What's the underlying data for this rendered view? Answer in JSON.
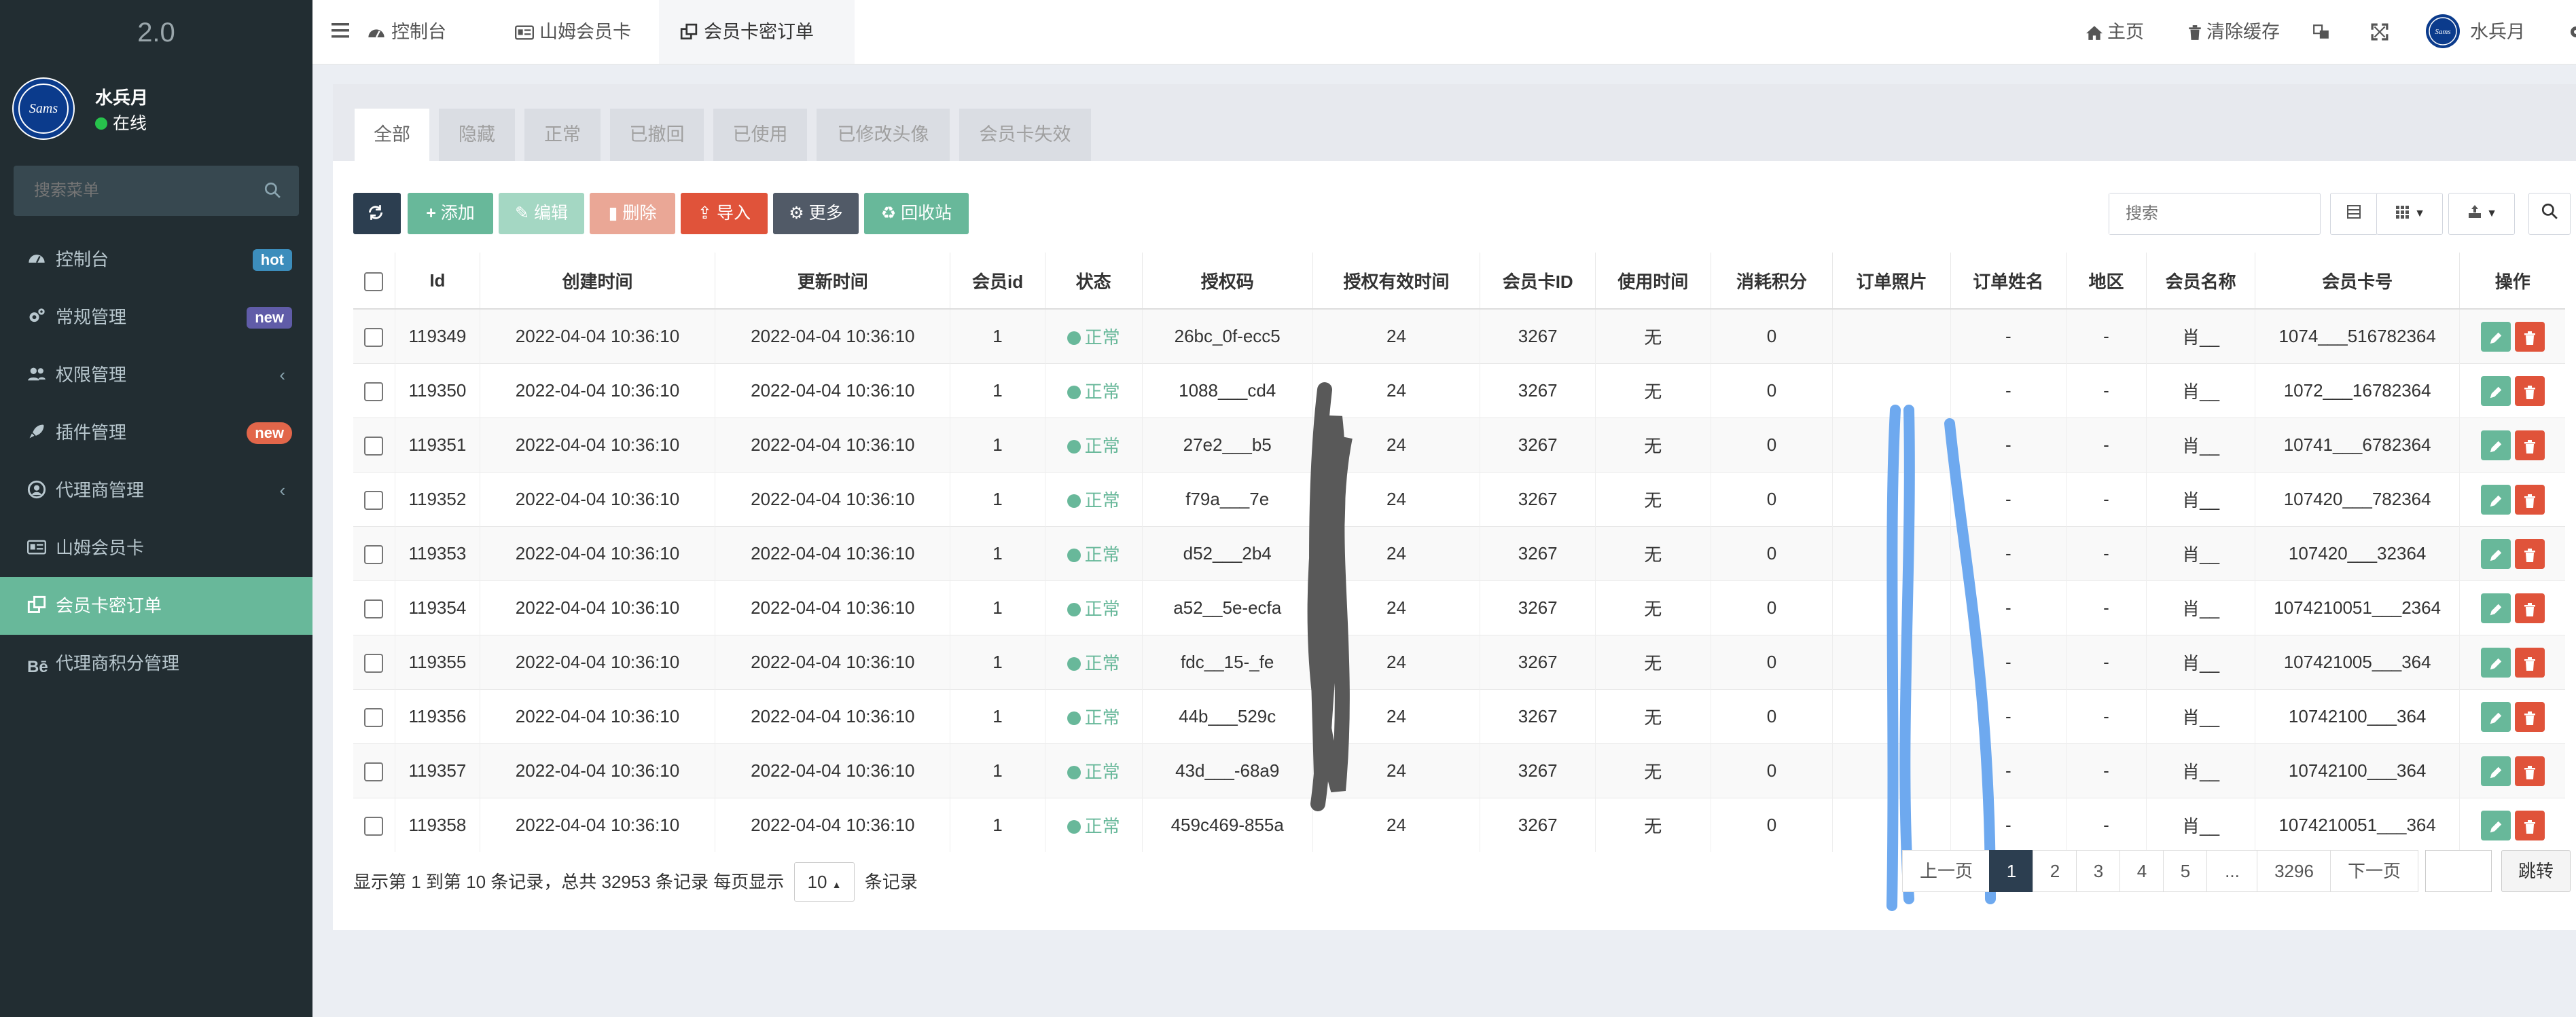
{
  "app": {
    "version": "2.0"
  },
  "user": {
    "name": "水兵月",
    "status": "在线"
  },
  "sidebar_search": {
    "placeholder": "搜索菜单"
  },
  "menu": [
    {
      "label": "控制台",
      "icon": "dashboard-icon",
      "badge": "hot"
    },
    {
      "label": "常规管理",
      "icon": "cogs-icon",
      "badge": "new"
    },
    {
      "label": "权限管理",
      "icon": "users-icon",
      "badge": ""
    },
    {
      "label": "插件管理",
      "icon": "rocket-icon",
      "badge": "new"
    },
    {
      "label": "代理商管理",
      "icon": "user-circle-icon",
      "badge": ""
    },
    {
      "label": "山姆会员卡",
      "icon": "id-card-icon",
      "badge": ""
    },
    {
      "label": "会员卡密订单",
      "icon": "clone-icon",
      "badge": ""
    },
    {
      "label": "代理商积分管理",
      "icon": "behance-icon",
      "badge": ""
    }
  ],
  "top_tabs": [
    "控制台",
    "山姆会员卡",
    "会员卡密订单"
  ],
  "top_right": {
    "home": "主页",
    "clear_cache": "清除缓存",
    "user": "水兵月"
  },
  "filter_tabs": [
    "全部",
    "隐藏",
    "正常",
    "已撤回",
    "已使用",
    "已修改头像",
    "会员卡失效"
  ],
  "toolbar": {
    "add": "添加",
    "edit": "编辑",
    "delete": "删除",
    "import": "导入",
    "more": "更多",
    "recycle": "回收站",
    "search_placeholder": "搜索"
  },
  "table": {
    "headers": [
      "Id",
      "创建时间",
      "更新时间",
      "会员id",
      "状态",
      "授权码",
      "授权有效时间",
      "会员卡ID",
      "使用时间",
      "消耗积分",
      "订单照片",
      "订单姓名",
      "地区",
      "会员名称",
      "会员卡号",
      "操作"
    ],
    "rows": [
      [
        "119349",
        "2022-04-04 10:36:10",
        "2022-04-04 10:36:10",
        "1",
        "正常",
        "26bc_0f-ecc5",
        "24",
        "3267",
        "无",
        "0",
        "",
        "-",
        "-",
        "肖__",
        "1074___516782364"
      ],
      [
        "119350",
        "2022-04-04 10:36:10",
        "2022-04-04 10:36:10",
        "1",
        "正常",
        "1088___cd4",
        "24",
        "3267",
        "无",
        "0",
        "",
        "-",
        "-",
        "肖__",
        "1072___16782364"
      ],
      [
        "119351",
        "2022-04-04 10:36:10",
        "2022-04-04 10:36:10",
        "1",
        "正常",
        "27e2___b5",
        "24",
        "3267",
        "无",
        "0",
        "",
        "-",
        "-",
        "肖__",
        "10741___6782364"
      ],
      [
        "119352",
        "2022-04-04 10:36:10",
        "2022-04-04 10:36:10",
        "1",
        "正常",
        "f79a___7e",
        "24",
        "3267",
        "无",
        "0",
        "",
        "-",
        "-",
        "肖__",
        "107420___782364"
      ],
      [
        "119353",
        "2022-04-04 10:36:10",
        "2022-04-04 10:36:10",
        "1",
        "正常",
        "d52___2b4",
        "24",
        "3267",
        "无",
        "0",
        "",
        "-",
        "-",
        "肖__",
        "107420___32364"
      ],
      [
        "119354",
        "2022-04-04 10:36:10",
        "2022-04-04 10:36:10",
        "1",
        "正常",
        "a52__5e-ecfa",
        "24",
        "3267",
        "无",
        "0",
        "",
        "-",
        "-",
        "肖__",
        "1074210051___2364"
      ],
      [
        "119355",
        "2022-04-04 10:36:10",
        "2022-04-04 10:36:10",
        "1",
        "正常",
        "fdc__15-_fe",
        "24",
        "3267",
        "无",
        "0",
        "",
        "-",
        "-",
        "肖__",
        "107421005___364"
      ],
      [
        "119356",
        "2022-04-04 10:36:10",
        "2022-04-04 10:36:10",
        "1",
        "正常",
        "44b___529c",
        "24",
        "3267",
        "无",
        "0",
        "",
        "-",
        "-",
        "肖__",
        "10742100___364"
      ],
      [
        "119357",
        "2022-04-04 10:36:10",
        "2022-04-04 10:36:10",
        "1",
        "正常",
        "43d___-68a9",
        "24",
        "3267",
        "无",
        "0",
        "",
        "-",
        "-",
        "肖__",
        "10742100___364"
      ],
      [
        "119358",
        "2022-04-04 10:36:10",
        "2022-04-04 10:36:10",
        "1",
        "正常",
        "459c469-855a",
        "24",
        "3267",
        "无",
        "0",
        "",
        "-",
        "-",
        "肖__",
        "1074210051___364"
      ]
    ]
  },
  "footer": {
    "summary": "显示第 1 到第 10 条记录，总共 32953 条记录 每页显示",
    "page_size": "10",
    "suffix": "条记录"
  },
  "pagination": {
    "prev": "上一页",
    "pages": [
      "1",
      "2",
      "3",
      "4",
      "5",
      "...",
      "3296"
    ],
    "next": "下一页",
    "jump": "跳转"
  }
}
